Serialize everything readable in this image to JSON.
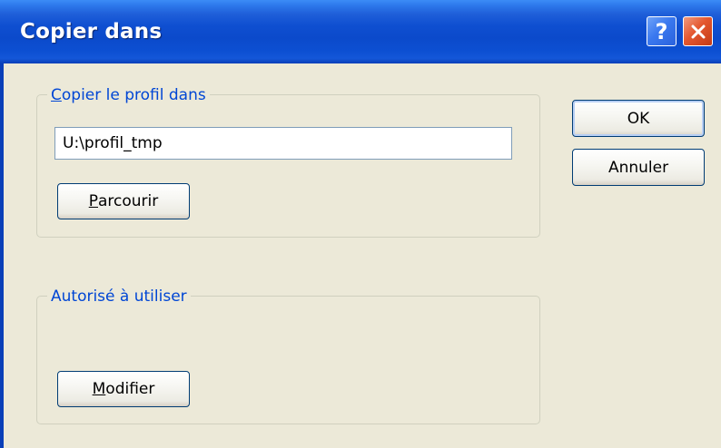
{
  "window": {
    "title": "Copier dans"
  },
  "titlebar": {
    "help_glyph": "?",
    "help_icon": "question-mark-icon",
    "close_icon": "close-x-icon",
    "colors": {
      "titlebar": "#0b4acb",
      "close": "#e4572f"
    }
  },
  "group_copy": {
    "legend_accel": "C",
    "legend_rest": "opier le profil dans",
    "path_value": "U:\\profil_tmp",
    "browse_accel": "P",
    "browse_rest": "arcourir"
  },
  "group_allowed": {
    "legend": "Autorisé à utiliser",
    "modify_accel": "M",
    "modify_rest": "odifier"
  },
  "actions": {
    "ok_label": "OK",
    "cancel_label": "Annuler"
  }
}
